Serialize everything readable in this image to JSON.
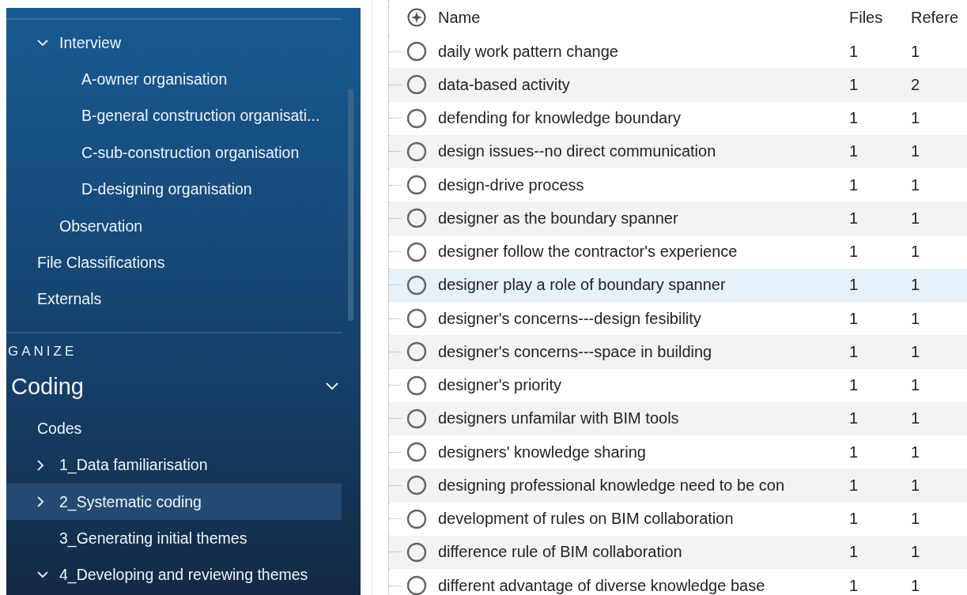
{
  "sidebar": {
    "tree": [
      {
        "children": [
          {
            "label": "Interview",
            "selected": false,
            "expanded": true,
            "children": [
              {
                "label": "A-owner organisation",
                "selected": false
              },
              {
                "label": "B-general construction organisati...",
                "selected": false
              },
              {
                "label": "C-sub-construction organisation",
                "selected": false
              },
              {
                "label": "D-designing organisation",
                "selected": false
              }
            ]
          },
          {
            "label": "Observation",
            "selected": false
          }
        ]
      },
      {
        "label": "File Classifications",
        "selected": false
      },
      {
        "label": "Externals",
        "selected": false
      }
    ],
    "section_label": "GANIZE",
    "group": {
      "title": "Coding",
      "expanded": true,
      "tree": [
        {
          "label": "Codes",
          "selected": false,
          "children": [
            {
              "label": "1_Data familiarisation",
              "selected": false,
              "expanded": false
            },
            {
              "label": "2_Systematic coding",
              "selected": true,
              "expanded": false
            },
            {
              "label": "3_Generating initial themes",
              "selected": false
            },
            {
              "label": "4_Developing and reviewing themes",
              "selected": false,
              "expanded": true
            }
          ]
        }
      ]
    }
  },
  "table": {
    "columns": [
      "Name",
      "Files",
      "Refere"
    ],
    "rows": [
      {
        "name": "daily work pattern change",
        "files": "1",
        "references": "1",
        "selected": false
      },
      {
        "name": "data-based activity",
        "files": "1",
        "references": "2",
        "selected": false
      },
      {
        "name": "defending for knowledge boundary",
        "files": "1",
        "references": "1",
        "selected": false
      },
      {
        "name": "design issues--no direct communication",
        "files": "1",
        "references": "1",
        "selected": false
      },
      {
        "name": "design-drive process",
        "files": "1",
        "references": "1",
        "selected": false
      },
      {
        "name": "designer as the boundary spanner",
        "files": "1",
        "references": "1",
        "selected": false
      },
      {
        "name": "designer follow the contractor's experience",
        "files": "1",
        "references": "1",
        "selected": false
      },
      {
        "name": "designer play a role of boundary spanner",
        "files": "1",
        "references": "1",
        "selected": true
      },
      {
        "name": "designer's concerns---design fesibility",
        "files": "1",
        "references": "1",
        "selected": false
      },
      {
        "name": "designer's concerns---space in building",
        "files": "1",
        "references": "1",
        "selected": false
      },
      {
        "name": "designer's priority",
        "files": "1",
        "references": "1",
        "selected": false
      },
      {
        "name": "designers unfamilar with BIM tools",
        "files": "1",
        "references": "1",
        "selected": false
      },
      {
        "name": "designers' knowledge sharing",
        "files": "1",
        "references": "1",
        "selected": false
      },
      {
        "name": "designing professional knowledge need to be con",
        "files": "1",
        "references": "1",
        "selected": false
      },
      {
        "name": "development of rules on BIM collaboration",
        "files": "1",
        "references": "1",
        "selected": false
      },
      {
        "name": "difference rule of BIM collaboration",
        "files": "1",
        "references": "1",
        "selected": false
      },
      {
        "name": "different advantage of diverse knowledge base",
        "files": "1",
        "references": "1",
        "selected": false
      }
    ]
  }
}
